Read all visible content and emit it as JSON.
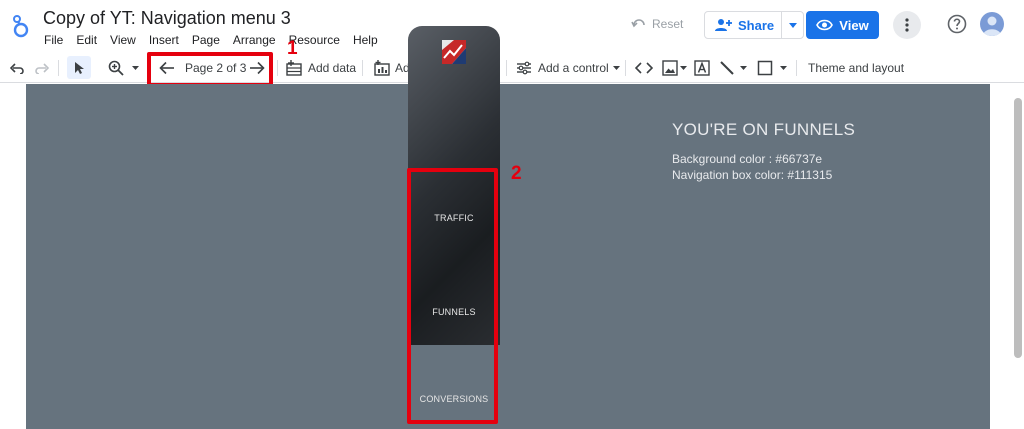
{
  "app": {
    "title": "Copy of YT: Navigation menu 3"
  },
  "menu": [
    "File",
    "Edit",
    "View",
    "Insert",
    "Page",
    "Arrange",
    "Resource",
    "Help"
  ],
  "header": {
    "reset_label": "Reset",
    "share_label": "Share",
    "view_label": "View"
  },
  "toolbar": {
    "page_indicator": "Page 2 of 3",
    "add_data": "Add data",
    "add_chart": "Add a chart",
    "add_control": "Add a control",
    "theme_layout": "Theme and layout"
  },
  "callouts": {
    "one": "1",
    "two": "2"
  },
  "canvas": {
    "heading": "YOU'RE ON FUNNELS",
    "bg_info": "Background color : #66737e",
    "nav_info": "Navigation box color: #111315",
    "nav_items": [
      "TRAFFIC",
      "FUNNELS",
      "CONVERSIONS"
    ]
  },
  "colors": {
    "canvas_bg": "#66737e",
    "nav_box": "#111315",
    "accent": "#1a73e8",
    "callout": "#e5000e"
  },
  "icons": [
    "looker-studio-logo-icon",
    "undo-icon",
    "redo-icon",
    "select-cursor-icon",
    "zoom-icon",
    "arrow-left-icon",
    "arrow-right-icon",
    "add-data-icon",
    "add-chart-icon",
    "community-viz-icon",
    "add-control-icon",
    "code-embed-icon",
    "image-icon",
    "text-icon",
    "line-icon",
    "shape-icon",
    "share-person-icon",
    "eye-icon",
    "more-vert-icon",
    "help-icon",
    "avatar-icon",
    "funnel-logo-icon"
  ]
}
